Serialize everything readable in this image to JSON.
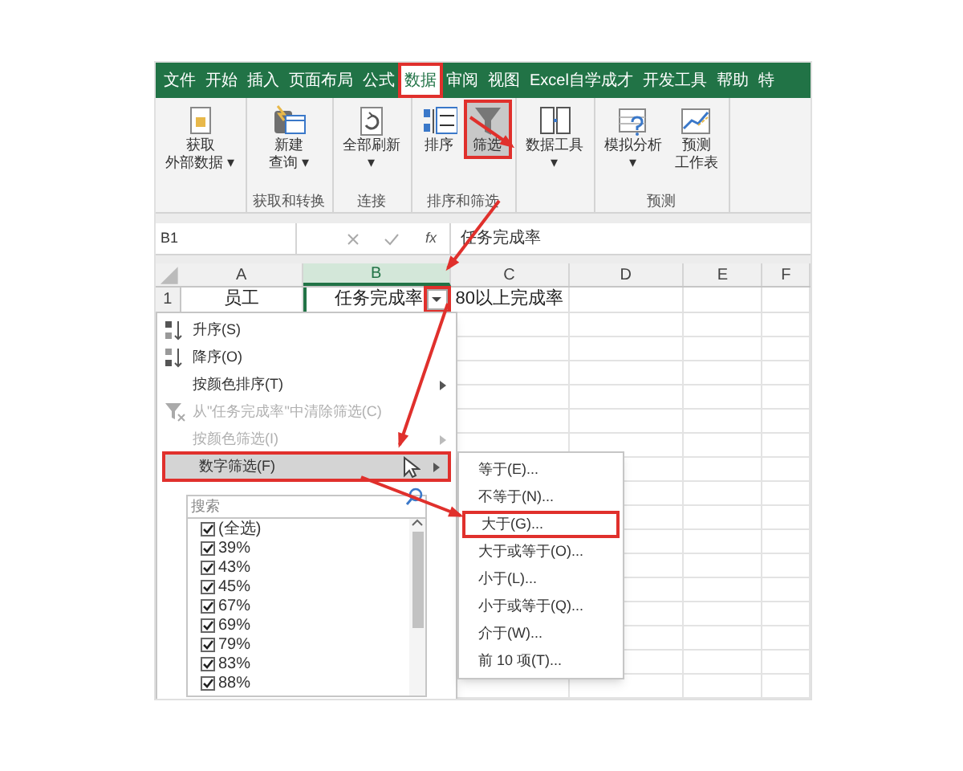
{
  "ribbon_tabs": [
    {
      "label": "文件",
      "selected": false,
      "highlighted": false
    },
    {
      "label": "开始",
      "selected": false,
      "highlighted": false
    },
    {
      "label": "插入",
      "selected": false,
      "highlighted": false
    },
    {
      "label": "页面布局",
      "selected": false,
      "highlighted": false
    },
    {
      "label": "公式",
      "selected": false,
      "highlighted": false
    },
    {
      "label": "数据",
      "selected": true,
      "highlighted": true
    },
    {
      "label": "审阅",
      "selected": false,
      "highlighted": false
    },
    {
      "label": "视图",
      "selected": false,
      "highlighted": false
    },
    {
      "label": "Excel自学成才",
      "selected": false,
      "highlighted": false
    },
    {
      "label": "开发工具",
      "selected": false,
      "highlighted": false
    },
    {
      "label": "帮助",
      "selected": false,
      "highlighted": false
    },
    {
      "label": "特",
      "selected": false,
      "highlighted": false
    }
  ],
  "ribbon_groups": [
    {
      "buttons": [
        {
          "kind": "get-data",
          "lines": [
            "获取",
            "外部数据 ▾"
          ],
          "highlighted": false
        }
      ]
    },
    {
      "label": "获取和转换",
      "buttons": [
        {
          "kind": "query",
          "lines": [
            "新建",
            "查询 ▾"
          ],
          "highlighted": false
        }
      ]
    },
    {
      "label": "连接",
      "buttons": [
        {
          "kind": "refresh",
          "lines": [
            "全部刷新",
            "▾"
          ],
          "highlighted": false
        }
      ]
    },
    {
      "label": "排序和筛选",
      "buttons": [
        {
          "kind": "sort",
          "lines": [
            "排序"
          ],
          "highlighted": false
        },
        {
          "kind": "filter",
          "lines": [
            "筛选"
          ],
          "highlighted": true
        }
      ]
    },
    {
      "buttons": [
        {
          "kind": "tools",
          "lines": [
            "数据工具",
            "▾"
          ],
          "highlighted": false
        }
      ]
    },
    {
      "label": "预测",
      "buttons": [
        {
          "kind": "what-if",
          "lines": [
            "模拟分析",
            "▾"
          ],
          "highlighted": false
        },
        {
          "kind": "forecast",
          "lines": [
            "预测",
            "工作表"
          ],
          "highlighted": false
        }
      ]
    }
  ],
  "formula_bar": {
    "name_box": "B1",
    "fx": "fx",
    "formula": "任务完成率"
  },
  "sheet": {
    "columns": [
      {
        "label": "A",
        "selected": false
      },
      {
        "label": "B",
        "selected": true,
        "filter_button": {
          "highlighted": true
        }
      },
      {
        "label": "C",
        "selected": false
      },
      {
        "label": "D",
        "selected": false
      },
      {
        "label": "E",
        "selected": false
      },
      {
        "label": "F",
        "selected": false
      }
    ],
    "rows": [
      {
        "number": "1",
        "cells": [
          "员工",
          "任务完成率",
          "80以上完成率"
        ]
      }
    ]
  },
  "filter_menu": {
    "items": [
      {
        "kind": "sort-asc",
        "label": "升序(S)",
        "disabled": false,
        "submenu": false,
        "highlighted": false
      },
      {
        "kind": "sort-desc",
        "label": "降序(O)",
        "disabled": false,
        "submenu": false,
        "highlighted": false
      },
      {
        "kind": "plain",
        "label": "按颜色排序(T)",
        "disabled": false,
        "submenu": true,
        "highlighted": false
      },
      {
        "kind": "clear-filter",
        "label": "从\"任务完成率\"中清除筛选(C)",
        "disabled": true,
        "submenu": false,
        "highlighted": false
      },
      {
        "kind": "plain",
        "label": "按颜色筛选(I)",
        "disabled": true,
        "submenu": true,
        "highlighted": false
      },
      {
        "kind": "plain",
        "label": "数字筛选(F)",
        "disabled": false,
        "submenu": true,
        "highlighted": true
      }
    ],
    "search": {
      "placeholder": "搜索"
    },
    "values": [
      {
        "label": "(全选)",
        "checked": true
      },
      {
        "label": "39%",
        "checked": true
      },
      {
        "label": "43%",
        "checked": true
      },
      {
        "label": "45%",
        "checked": true
      },
      {
        "label": "67%",
        "checked": true
      },
      {
        "label": "69%",
        "checked": true
      },
      {
        "label": "79%",
        "checked": true
      },
      {
        "label": "83%",
        "checked": true
      },
      {
        "label": "88%",
        "checked": true
      }
    ]
  },
  "number_filter_menu": {
    "items": [
      {
        "label": "等于(E)...",
        "highlighted": false
      },
      {
        "label": "不等于(N)...",
        "highlighted": false
      },
      {
        "label": "大于(G)...",
        "highlighted": true
      },
      {
        "label": "大于或等于(O)...",
        "highlighted": false
      },
      {
        "label": "小于(L)...",
        "highlighted": false
      },
      {
        "label": "小于或等于(Q)...",
        "highlighted": false
      },
      {
        "label": "介于(W)...",
        "highlighted": false
      },
      {
        "label": "前 10 项(T)...",
        "highlighted": false
      }
    ]
  }
}
